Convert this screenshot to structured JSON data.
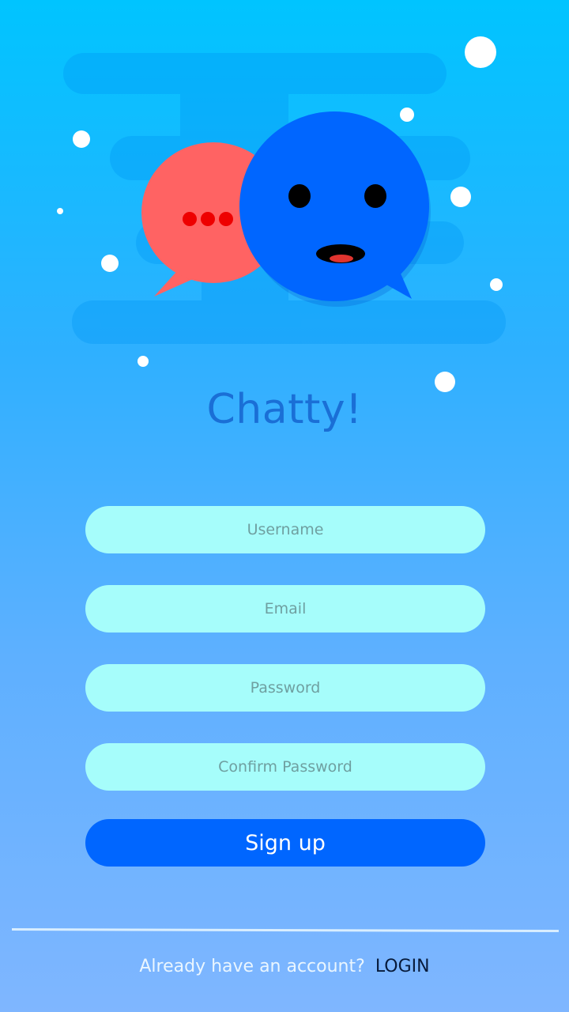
{
  "app": {
    "title": "Chatty!"
  },
  "form": {
    "username_placeholder": "Username",
    "email_placeholder": "Email",
    "password_placeholder": "Password",
    "confirm_placeholder": "Confirm Password",
    "signup_label": "Sign up"
  },
  "footer": {
    "question": "Already have an account?",
    "login_label": "LOGIN"
  },
  "colors": {
    "background_top": "#00c4ff",
    "background_bottom": "#7fb6ff",
    "field_fill": "#a6fdfb",
    "button_fill": "#0066ff",
    "title": "#1a6fd6",
    "red_bubble": "#ff6363",
    "blue_bubble": "#0066ff"
  },
  "icons": {
    "illustration": "chat-bubbles-illustration",
    "red_bubble": "typing-chat-bubble-icon",
    "blue_bubble": "smiling-chat-bubble-icon"
  }
}
